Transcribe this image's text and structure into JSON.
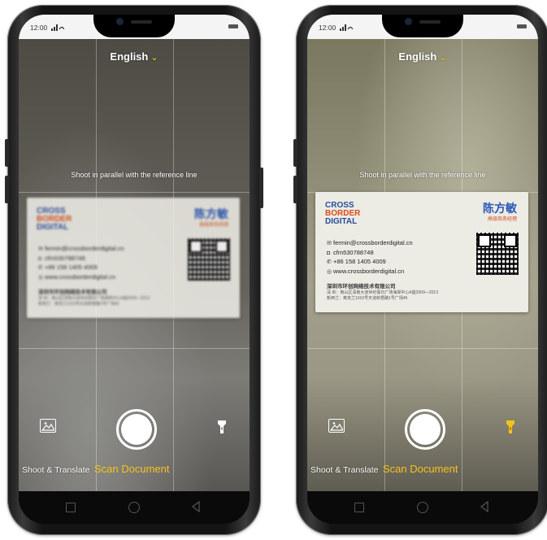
{
  "screens": [
    {
      "status_time": "12:00",
      "language_label": "English",
      "hint": "Shoot in parallel with the reference line",
      "card": {
        "logo_line1": "CROSS",
        "logo_line2": "BORDER",
        "logo_line3": "DIGITAL",
        "name": "陈方敏",
        "title": "高级商务经理",
        "email": "fermin@crossborderdigital.cn",
        "wechat": "cfm530788748",
        "phone": "+86 158 1405 4009",
        "web": "www.crossborderdigital.cn",
        "company": "深圳市环创网络技术有限公司",
        "address1": "深 圳：南山区深南大道世纪假日广场海岸中心A座2009—2013",
        "address2": "新西兰：奥克兰1010号天道新梧路1号广场45"
      },
      "mode_translate": "Shoot & Translate",
      "mode_scan": "Scan Document"
    },
    {
      "status_time": "12:00",
      "language_label": "English",
      "hint": "Shoot in parallel with the reference line",
      "card": {
        "logo_line1": "CROSS",
        "logo_line2": "BORDER",
        "logo_line3": "DIGITAL",
        "name": "陈方敏",
        "title": "高级商务经理",
        "email": "fermin@crossborderdigital.cn",
        "wechat": "cfm530788748",
        "phone": "+86 158 1405 4009",
        "web": "www.crossborderdigital.cn",
        "company": "深圳市环创网络技术有限公司",
        "address1": "深 圳：南山区深南大道世纪假日广场海岸中心A座2009—2013",
        "address2": "新西兰：奥克兰1010号天道新梧路1号广场45"
      },
      "mode_translate": "Shoot & Translate",
      "mode_scan": "Scan Document"
    }
  ],
  "icons": [
    "signal-icon",
    "wifi-icon",
    "battery-icon",
    "chevron-down-icon",
    "gallery-icon",
    "shutter-button",
    "flashlight-icon",
    "nav-recents-icon",
    "nav-home-icon",
    "nav-back-icon"
  ],
  "colors": {
    "accent": "#f6c21a",
    "flash_active": "#f6c21a",
    "flash_inactive": "#ffffff"
  }
}
